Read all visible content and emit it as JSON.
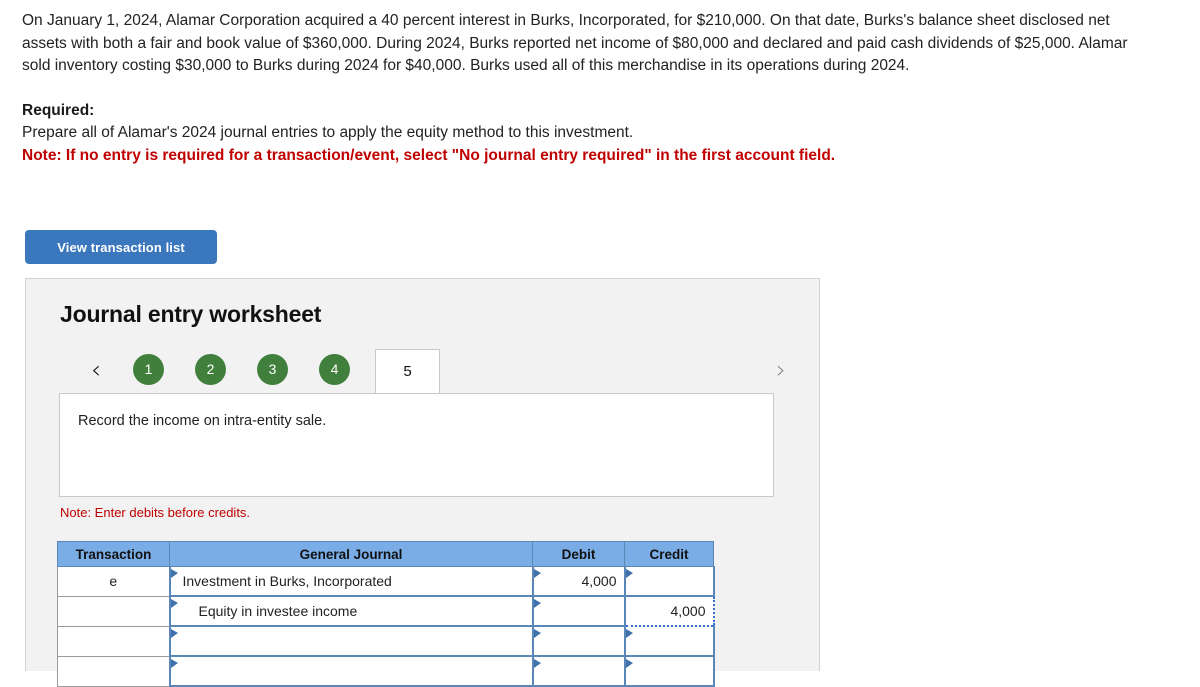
{
  "problem": {
    "paragraph": "On January 1, 2024, Alamar Corporation acquired a 40 percent interest in Burks, Incorporated, for $210,000. On that date, Burks's balance sheet disclosed net assets with both a fair and book value of $360,000. During 2024, Burks reported net income of $80,000 and declared and paid cash dividends of $25,000. Alamar sold inventory costing $30,000 to Burks during 2024 for $40,000. Burks used all of this merchandise in its operations during 2024.",
    "required_title": "Required:",
    "required_line": "Prepare all of Alamar's 2024 journal entries to apply the equity method to this investment.",
    "required_note": "Note: If no entry is required for a transaction/event, select \"No journal entry required\" in the first account field."
  },
  "toolbar": {
    "view_transaction_list_label": "View transaction list"
  },
  "worksheet": {
    "title": "Journal entry worksheet",
    "prev_icon": "chevron-left-icon",
    "next_icon": "chevron-right-icon",
    "tabs": [
      {
        "label": "1",
        "state": "completed"
      },
      {
        "label": "2",
        "state": "completed"
      },
      {
        "label": "3",
        "state": "completed"
      },
      {
        "label": "4",
        "state": "completed"
      },
      {
        "label": "5",
        "state": "active"
      }
    ],
    "description": "Record the income on intra-entity sale.",
    "enter_note": "Note: Enter debits before credits."
  },
  "journal": {
    "columns": [
      "Transaction",
      "General Journal",
      "Debit",
      "Credit"
    ],
    "rows": [
      {
        "transaction": "e",
        "account": "Investment in Burks, Incorporated",
        "indent": false,
        "debit": "4,000",
        "credit": "",
        "focus": ""
      },
      {
        "transaction": "",
        "account": "Equity in investee income",
        "indent": true,
        "debit": "",
        "credit": "4,000",
        "focus": "credit"
      },
      {
        "transaction": "",
        "account": "",
        "indent": false,
        "debit": "",
        "credit": "",
        "focus": ""
      },
      {
        "transaction": "",
        "account": "",
        "indent": false,
        "debit": "",
        "credit": "",
        "focus": ""
      }
    ]
  },
  "colors": {
    "button_blue": "#3a77bd",
    "tab_green": "#41803c",
    "header_blue": "#7aace6",
    "note_red": "#c00000",
    "cell_border_blue": "#5b87b8",
    "focus_blue": "#3a6fd8"
  }
}
